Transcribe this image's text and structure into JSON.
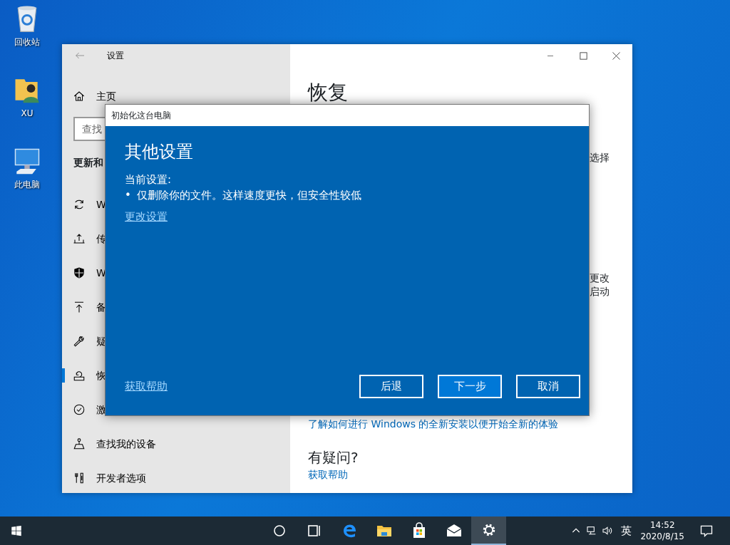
{
  "desktop_icons": [
    {
      "label": "回收站",
      "kind": "recycle"
    },
    {
      "label": "XU",
      "kind": "user"
    },
    {
      "label": "此电脑",
      "kind": "computer"
    }
  ],
  "settings_window": {
    "title": "设置",
    "sidebar": {
      "home": "主页",
      "search": {
        "placeholder": "查找"
      },
      "section": "更新和",
      "items": [
        {
          "label": "W",
          "kind": "sync",
          "selected": false
        },
        {
          "label": "传",
          "kind": "delivery",
          "selected": false
        },
        {
          "label": "W",
          "kind": "shield",
          "selected": false
        },
        {
          "label": "备",
          "kind": "backup",
          "selected": false
        },
        {
          "label": "疑",
          "kind": "wrench",
          "selected": false
        },
        {
          "label": "恢",
          "kind": "recovery",
          "selected": true
        },
        {
          "label": "激",
          "kind": "check",
          "selected": false
        },
        {
          "label": "查找我的设备",
          "kind": "find",
          "selected": false
        },
        {
          "label": "开发者选项",
          "kind": "tools",
          "selected": false
        }
      ]
    },
    "content": {
      "heading": "恢复",
      "fragments": [
        "选择",
        "更改",
        "启动"
      ],
      "link": "了解如何进行 Windows 的全新安装以便开始全新的体验",
      "question": "有疑问?",
      "help_link": "获取帮助"
    }
  },
  "dialog": {
    "title": "初始化这台电脑",
    "heading": "其他设置",
    "label": "当前设置:",
    "items": [
      {
        "bullet": "•",
        "text": "仅删除你的文件。这样速度更快，但安全性较低"
      }
    ],
    "change_link": "更改设置",
    "help_link": "获取帮助",
    "buttons": [
      {
        "label": "后退",
        "primary": false
      },
      {
        "label": "下一步",
        "primary": true
      },
      {
        "label": "取消",
        "primary": false
      }
    ]
  },
  "taskbar": {
    "apps": [
      {
        "kind": "cortana",
        "selected": false
      },
      {
        "kind": "taskview",
        "selected": false
      },
      {
        "kind": "browser",
        "selected": false
      },
      {
        "kind": "folder",
        "selected": false
      },
      {
        "kind": "store",
        "selected": false
      },
      {
        "kind": "mail",
        "selected": false
      },
      {
        "kind": "settings",
        "selected": true
      }
    ],
    "language": "英",
    "time": "14:52",
    "date": "2020/8/15"
  }
}
